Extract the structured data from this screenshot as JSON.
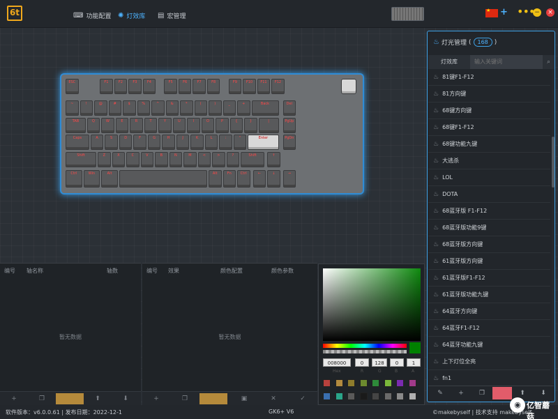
{
  "header": {
    "logo": "6t",
    "tabs": [
      {
        "label": "功能配置",
        "icon": "keyboard-icon"
      },
      {
        "label": "灯效库",
        "icon": "gear-icon"
      },
      {
        "label": "宏管理",
        "icon": "document-icon"
      }
    ],
    "plus": "+",
    "dots": "•••",
    "min": "−",
    "close": "×"
  },
  "keyboard": {
    "keys": [
      "ESC",
      "F1",
      "F2",
      "F3",
      "F4",
      "F5",
      "F6",
      "F7",
      "F8",
      "F9",
      "F10",
      "F11",
      "F12",
      "~",
      "!",
      "@",
      "#",
      "$",
      "%",
      "^",
      "&",
      "*",
      "(",
      ")",
      "_",
      "+",
      "Back",
      "Del",
      "TAB",
      "Q",
      "W",
      "E",
      "R",
      "T",
      "Y",
      "U",
      "I",
      "O",
      "P",
      "{",
      "}",
      "|",
      "PgUp",
      "Caps",
      "A",
      "S",
      "D",
      "F",
      "G",
      "H",
      "J",
      "K",
      "L",
      ":",
      "\"",
      "Enter",
      "PgDn",
      "Shift",
      "Z",
      "X",
      "C",
      "V",
      "B",
      "N",
      "M",
      "<",
      ">",
      "?",
      "Shift",
      "↑",
      "Ctrl",
      "Win",
      "Alt",
      "Alt",
      "Fn",
      "Ctrl",
      "←",
      "↓",
      "→"
    ]
  },
  "left_panel": {
    "col_no": "编号",
    "col_name": "轴名称",
    "col_count": "轴数",
    "empty": "暂无数据",
    "buttons": [
      "+",
      "❐",
      "",
      "⬆",
      "⬇"
    ]
  },
  "mid_panel": {
    "col_no": "编号",
    "col_effect": "效果",
    "col_color": "颜色配置",
    "col_param": "颜色参数",
    "empty": "暂无数据",
    "buttons": [
      "+",
      "❐",
      "",
      "▣",
      "✕",
      "✓"
    ]
  },
  "picker": {
    "hex": "008000",
    "r": "0",
    "g": "128",
    "b": "0",
    "a": "1",
    "labels": [
      "Hex",
      "R",
      "G",
      "B",
      "A"
    ],
    "swatches": [
      "#b7413d",
      "#b38b3f",
      "#8e7c2c",
      "#6d8a2f",
      "#2e8a3a",
      "#7bb83b",
      "#7b2bb0",
      "#a13a8a",
      "#3a6fb0",
      "#2aa58a",
      "#5a5a5a",
      "#1a1a1a",
      "#454545",
      "#6a6a6a",
      "#8a8a8a",
      "#b0b0b0"
    ]
  },
  "right_panel": {
    "title": "灯光管理",
    "count": "168",
    "tab": "灯效库",
    "search_placeholder": "输入关键词",
    "items": [
      "81键F1-F12",
      "81方向键",
      "68键方向键",
      "68键F1-F12",
      "68键功能九键",
      "大逃杀",
      "LOL",
      "DOTA",
      "68蓝牙版 F1-F12",
      "68蓝牙版功能9键",
      "68蓝牙版方向键",
      "61蓝牙版方向键",
      "61蓝牙版F1-F12",
      "61蓝牙版功能九键",
      "64蓝牙方向键",
      "64蓝牙F1-F12",
      "64蓝牙功能九键",
      "上下灯位全亮",
      "fn1"
    ],
    "bar": [
      "✎",
      "+",
      "❐",
      "",
      "⬆",
      "⬇"
    ]
  },
  "status": {
    "version": "软件版本：v6.0.0.61 | 发布日期：2022-12-1",
    "model": "GK6+ V6",
    "support": "©makebyself | 技术支持 makebyself"
  },
  "watermark": "亿智蘑菇",
  "colors": {
    "accent": "#4db3ff",
    "logo": "#f0a81c",
    "danger": "#e25c6a"
  }
}
